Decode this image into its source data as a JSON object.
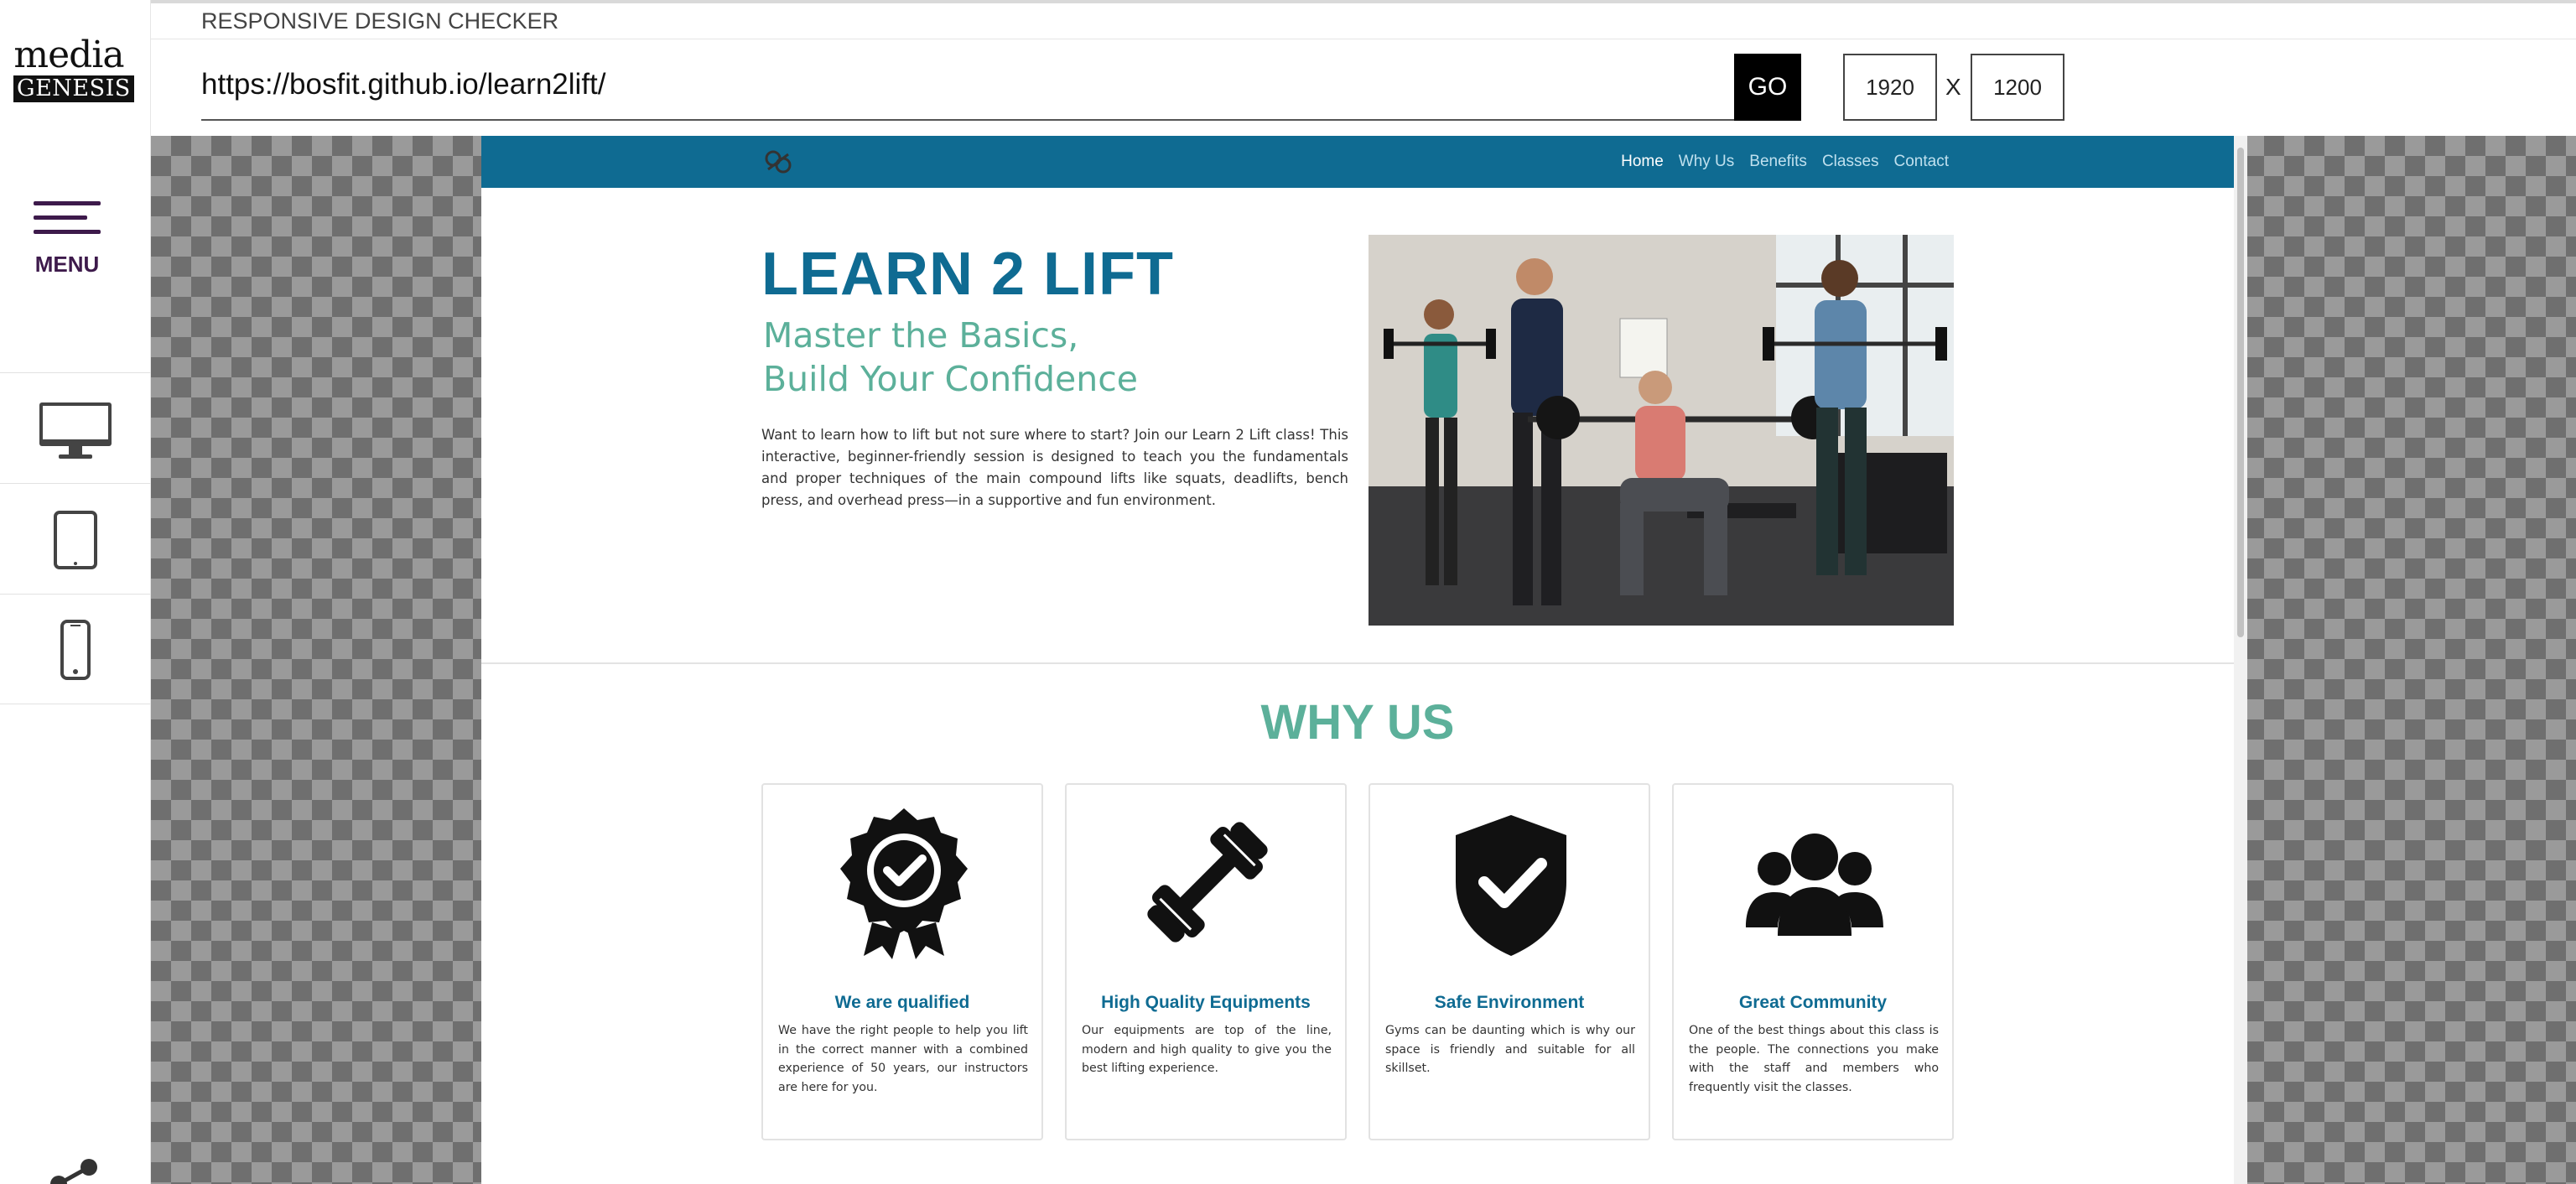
{
  "app": {
    "logo_top": "media",
    "logo_bottom": "GENESIS",
    "title": "RESPONSIVE DESIGN CHECKER",
    "menu_label": "MENU"
  },
  "toolbar": {
    "url": "https://bosfit.github.io/learn2lift/",
    "go_label": "GO",
    "width": "1920",
    "separator": "X",
    "height": "1200"
  },
  "devices": [
    {
      "name": "desktop",
      "icon": "desktop-icon"
    },
    {
      "name": "tablet",
      "icon": "tablet-icon"
    },
    {
      "name": "mobile",
      "icon": "mobile-icon"
    }
  ],
  "site": {
    "nav": [
      "Home",
      "Why Us",
      "Benefits",
      "Classes",
      "Contact"
    ],
    "active_nav": "Home",
    "hero": {
      "title": "LEARN 2 LIFT",
      "subtitle_line1": "Master the Basics,",
      "subtitle_line2": "Build Your Confidence",
      "text": "Want to learn how to lift but not sure where to start? Join our Learn 2 Lift class! This interactive, beginner-friendly session is designed to teach you the fundamentals and proper techniques of the main compound lifts like squats, deadlifts, bench press, and overhead press—in a supportive and fun environment."
    },
    "why_us": {
      "title": "WHY US",
      "cards": [
        {
          "icon": "award-badge-icon",
          "title": "We are qualified",
          "text": "We have the right people to help you lift in the correct manner with a combined experience of 50 years, our instructors are here for you."
        },
        {
          "icon": "dumbbell-icon",
          "title": "High Quality Equipments",
          "text": "Our equipments are top of the line, modern and high quality to give you the best lifting experience."
        },
        {
          "icon": "shield-check-icon",
          "title": "Safe Environment",
          "text": "Gyms can be daunting which is why our space is friendly and suitable for all skillset."
        },
        {
          "icon": "users-group-icon",
          "title": "Great Community",
          "text": "One of the best things about this class is the people. The connections you make with the staff and members who frequently visit the classes."
        }
      ]
    }
  },
  "colors": {
    "brand_blue": "#0f6b92",
    "accent_green": "#5cb09a",
    "menu_purple": "#3d1a4b"
  }
}
